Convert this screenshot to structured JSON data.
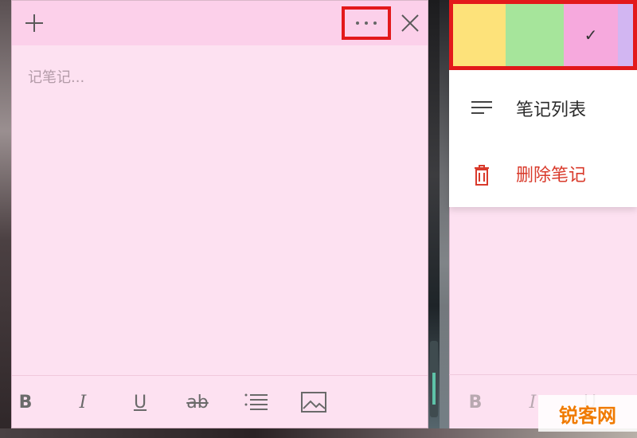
{
  "left_note": {
    "toolbar": {
      "add_icon": "plus-icon",
      "more_icon": "ellipsis-icon",
      "close_icon": "close-icon"
    },
    "placeholder": "记笔记...",
    "format_toolbar": {
      "bold": "B",
      "italic": "I",
      "underline": "U",
      "strikethrough": "ab",
      "list_icon": "bullet-list-icon",
      "image_icon": "image-icon"
    }
  },
  "right_note": {
    "colors": [
      {
        "name": "yellow",
        "hex": "#fde27a"
      },
      {
        "name": "green",
        "hex": "#a6e59b"
      },
      {
        "name": "pink",
        "hex": "#f6a9dd",
        "selected": true
      },
      {
        "name": "purple",
        "hex": "#d2b6f2"
      }
    ],
    "check_mark": "✓",
    "menu": {
      "notes_list": "笔记列表",
      "delete_note": "删除笔记"
    },
    "format_toolbar": {
      "bold": "B",
      "italic": "I",
      "underline": "U"
    }
  },
  "watermark": "锐客网",
  "accent_colors": {
    "highlight_border": "#e3191b",
    "delete_text": "#d93a2b",
    "note_background": "#fde1f1",
    "note_toolbar": "#fcd0ea"
  }
}
